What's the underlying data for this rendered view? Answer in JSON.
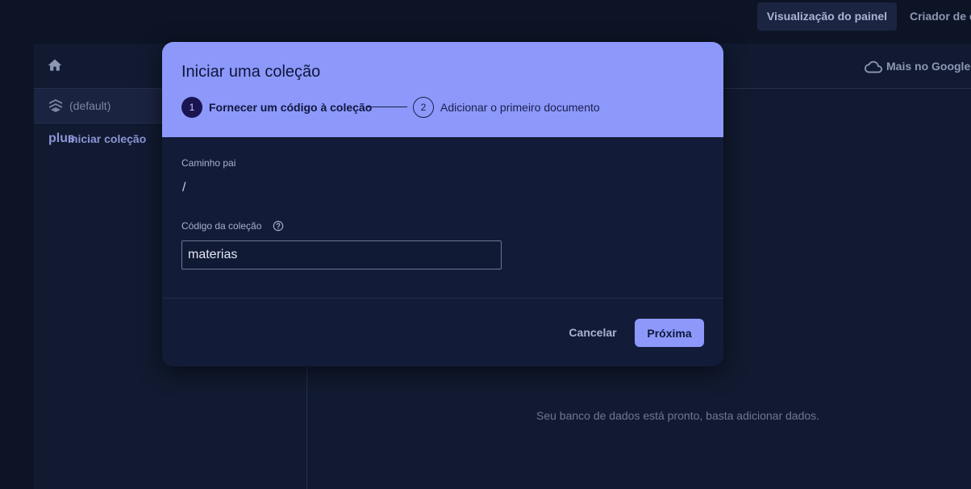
{
  "top_tabs": [
    {
      "label": "Visualização do painel",
      "active": true
    },
    {
      "label": "Criador de c",
      "active": false
    }
  ],
  "panel": {
    "home_icon": "home-icon",
    "more_google_icon": "cloud-icon",
    "more_google_label": "Mais no Google",
    "database_icon": "stack-icon",
    "database_label": "(default)",
    "start_collection_icon": "plus",
    "start_collection_label": "Iniciar coleção",
    "empty_message": "Seu banco de dados está pronto, basta adicionar dados."
  },
  "dialog": {
    "title": "Iniciar uma coleção",
    "steps": [
      {
        "number": "1",
        "label": "Fornecer um código à coleção",
        "active": true
      },
      {
        "number": "2",
        "label": "Adicionar o primeiro documento",
        "active": false
      }
    ],
    "parent_path_label": "Caminho pai",
    "parent_path_value": "/",
    "collection_code_label": "Código da coleção",
    "help_icon": "help-circle-icon",
    "collection_code_value": "materias",
    "cancel_label": "Cancelar",
    "next_label": "Próxima"
  },
  "colors": {
    "accent": "#8c99fb",
    "background": "#0d1426",
    "dialog_body": "#121c38"
  }
}
